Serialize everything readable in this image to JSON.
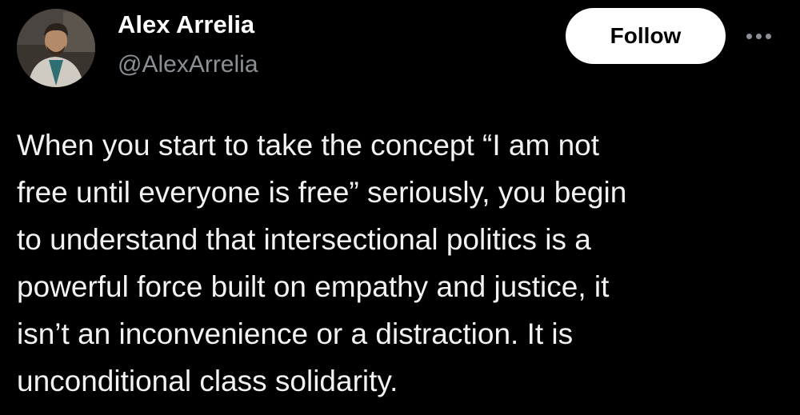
{
  "author": {
    "name": "Alex Arrelia",
    "handle": "@AlexArrelia",
    "avatar_icon": "profile-photo"
  },
  "actions": {
    "follow_label": "Follow",
    "more_icon": "more-dots-icon"
  },
  "tweet": {
    "lines": [
      "When you start to take the concept “I am not",
      "free until everyone is free” seriously, you begin",
      "to understand that intersectional politics is a",
      "powerful force built on empathy and justice, it",
      "isn’t an inconvenience or a distraction. It is",
      "unconditional class solidarity."
    ]
  },
  "colors": {
    "background": "#000000",
    "text": "#ffffff",
    "secondary_text": "#8b9096",
    "follow_button_bg": "#ffffff",
    "follow_button_text": "#000000"
  }
}
